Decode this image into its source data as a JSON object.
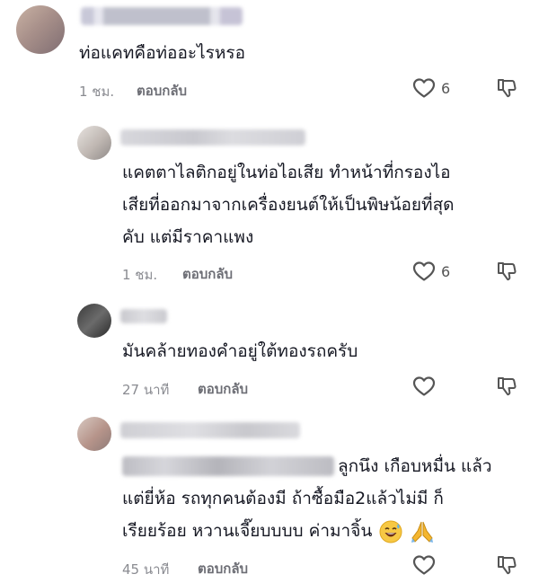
{
  "comments": [
    {
      "text": "ท่อแคทคือท่ออะไรหรอ",
      "time": "1 ชม.",
      "reply_label": "ตอบกลับ",
      "likes": "6"
    },
    {
      "lines": [
        "แคตตาไลติกอยู่ในท่อไอเสีย ทำหน้าที่กรองไอ",
        "เสียที่ออกมาจากเครื่องยนต์ให้เป็นพิษน้อยที่สุด",
        "คับ แต่มีราคาแพง"
      ],
      "time": "1 ชม.",
      "reply_label": "ตอบกลับ",
      "likes": "6"
    },
    {
      "text": "มันคล้ายทองคำอยู่ใต้ทองรถครับ",
      "time": "27 นาที",
      "reply_label": "ตอบกลับ"
    },
    {
      "lines": [
        "ลูกนึง เกือบหมื่น แล้ว",
        "แต่ยี่ห้อ รถทุกคนต้องมี ถ้าซื้อมือ2แล้วไม่มี ก็",
        "เรียยร้อย หวานเจี๊ยบบบบ ค่ามาจิ้น"
      ],
      "time": "45 นาที",
      "reply_label": "ตอบกลับ"
    }
  ],
  "icons": {
    "like": "heart-outline",
    "dislike": "thumbs-down-outline",
    "emoji_1": "sweat-smile-emoji",
    "emoji_2": "folded-hands-emoji"
  }
}
